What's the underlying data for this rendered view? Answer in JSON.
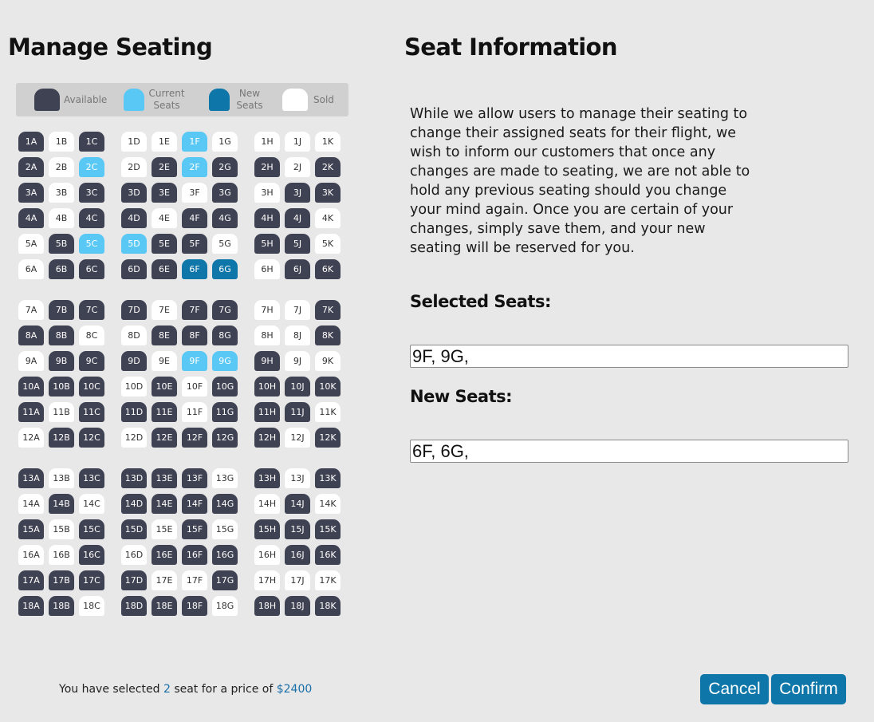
{
  "titles": {
    "manage": "Manage Seating",
    "info": "Seat Information"
  },
  "legend": {
    "available": "Available",
    "current_line1": "Current",
    "current_line2": "Seats",
    "new_line1": "New",
    "new_line2": "Seats",
    "sold": "Sold"
  },
  "colors": {
    "available": "#3f4252",
    "current": "#5ac8f5",
    "new": "#0e76a8",
    "sold": "#ffffff",
    "accent": "#0e76a8",
    "background": "#e8e8e8"
  },
  "seat_map": {
    "letters": [
      "A",
      "B",
      "C",
      "D",
      "E",
      "F",
      "G",
      "H",
      "J",
      "K"
    ],
    "rows": [
      {
        "row": "1",
        "states": "ASASSCSSSS"
      },
      {
        "row": "2",
        "states": "ASCSACAASA"
      },
      {
        "row": "3",
        "states": "ASAAASASAA"
      },
      {
        "row": "4",
        "states": "ASAASAAAAS"
      },
      {
        "row": "5",
        "states": "SACCAASAAS"
      },
      {
        "row": "6",
        "states": "SAAAANNSAA"
      },
      {
        "row": "7",
        "states": "SAAASAASSA"
      },
      {
        "row": "8",
        "states": "AASSAAASSA"
      },
      {
        "row": "9",
        "states": "SAAASCCASS"
      },
      {
        "row": "10",
        "states": "AAASASAAAA"
      },
      {
        "row": "11",
        "states": "ASAAASAAAS"
      },
      {
        "row": "12",
        "states": "SAASAAAASA"
      },
      {
        "row": "13",
        "states": "ASAAAASASA"
      },
      {
        "row": "14",
        "states": "SASAAAASAS"
      },
      {
        "row": "15",
        "states": "ASAASASAAA"
      },
      {
        "row": "16",
        "states": "SSASAAASAA"
      },
      {
        "row": "17",
        "states": "AAAASSASSS"
      },
      {
        "row": "18",
        "states": "AASAAASAAA"
      }
    ]
  },
  "info": {
    "text": "While we allow users to manage their seating to change their assigned seats for their flight, we wish to inform our customers that once any changes are made to seating, we are not able to hold any previous seating should you change your mind again. Once you are certain of your changes, simply save them, and your new seating will be reserved for you.",
    "selected_heading": "Selected Seats:",
    "selected_value": "9F, 9G,",
    "new_heading": "New Seats:",
    "new_value": "6F, 6G,"
  },
  "summary": {
    "prefix": "You have selected",
    "count": "2",
    "middle": "seat for a price of",
    "price": "$2400"
  },
  "buttons": {
    "cancel": "Cancel",
    "confirm": "Confirm"
  }
}
